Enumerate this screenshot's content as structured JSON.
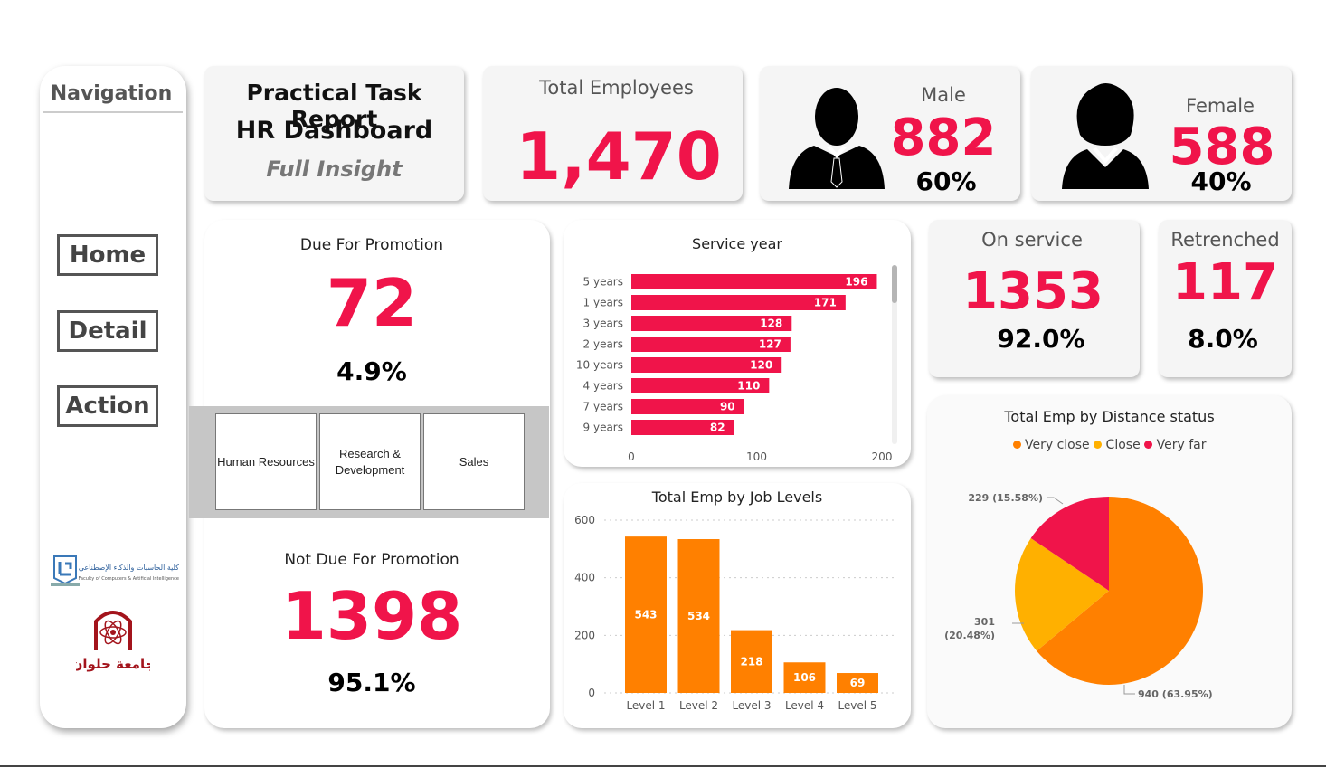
{
  "nav": {
    "title": "Navigation",
    "buttons": [
      "Home",
      "Detail",
      "Action"
    ],
    "logos": {
      "faculty_text_ar": "كلية الحاسبات والذكاء الإصطناعي",
      "faculty_text_en": "Faculty of Computers & Artificial Intelligence",
      "university_ar": "جامعة حلوان"
    }
  },
  "header": {
    "line1": "Practical Task Report",
    "line2": "HR Dashboard",
    "line3": "Full Insight"
  },
  "total": {
    "label": "Total Employees",
    "value": "1,470"
  },
  "male": {
    "label": "Male",
    "value": "882",
    "pct": "60%",
    "icon": "male-person-icon"
  },
  "female": {
    "label": "Female",
    "value": "588",
    "pct": "40%",
    "icon": "female-person-icon"
  },
  "promotion": {
    "due_label": "Due For Promotion",
    "due_value": "72",
    "due_pct": "4.9%",
    "not_due_label": "Not Due For Promotion",
    "not_due_value": "1398",
    "not_due_pct": "95.1%",
    "departments": [
      "Human Resources",
      "Research & Development",
      "Sales"
    ]
  },
  "on_service": {
    "label": "On service",
    "value": "1353",
    "pct": "92.0%"
  },
  "retrenched": {
    "label": "Retrenched",
    "value": "117",
    "pct": "8.0%"
  },
  "colors": {
    "accent": "#f0144a",
    "orange": "#ff8000",
    "amber": "#ffb000"
  },
  "chart_data": [
    {
      "type": "bar",
      "orientation": "horizontal",
      "title": "Service year",
      "categories": [
        "5 years",
        "1 years",
        "3 years",
        "2 years",
        "10 years",
        "4 years",
        "7 years",
        "9 years"
      ],
      "values": [
        196,
        171,
        128,
        127,
        120,
        110,
        90,
        82
      ],
      "xlim": [
        0,
        200
      ],
      "ticks": [
        "0",
        "100",
        "200"
      ],
      "color": "#f0144a"
    },
    {
      "type": "bar",
      "title": "Total Emp by Job Levels",
      "categories": [
        "Level 1",
        "Level 2",
        "Level 3",
        "Level 4",
        "Level 5"
      ],
      "values": [
        543,
        534,
        218,
        106,
        69
      ],
      "ylim": [
        0,
        600
      ],
      "ticks": [
        "0",
        "200",
        "400",
        "600"
      ],
      "grid": true,
      "color": "#ff8000"
    },
    {
      "type": "pie",
      "title": "Total Emp by Distance status",
      "legend": [
        {
          "name": "Very close",
          "color": "#ff8000"
        },
        {
          "name": "Close",
          "color": "#ffb000"
        },
        {
          "name": "Very far",
          "color": "#f0144a"
        }
      ],
      "legend_position": "top",
      "slices": [
        {
          "name": "Very close",
          "value": 940,
          "label": "940 (63.95%)",
          "color": "#ff8000"
        },
        {
          "name": "Close",
          "value": 301,
          "label_line1": "301",
          "label_line2": "(20.48%)",
          "color": "#ffb000"
        },
        {
          "name": "Very far",
          "value": 229,
          "label": "229 (15.58%)",
          "color": "#f0144a"
        }
      ]
    }
  ]
}
